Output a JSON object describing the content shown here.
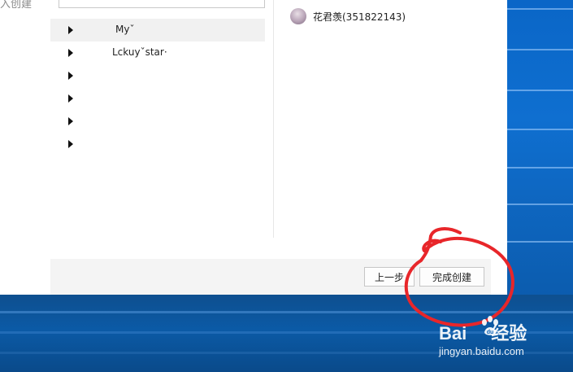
{
  "dialog": {
    "left_label": "入创建",
    "tree": [
      {
        "label": "Myˇ",
        "selected": true
      },
      {
        "label": "Lckuyˇstar·",
        "selected": false
      },
      {
        "label": "",
        "selected": false
      },
      {
        "label": "",
        "selected": false
      },
      {
        "label": "",
        "selected": false
      },
      {
        "label": "",
        "selected": false
      }
    ],
    "member": {
      "name": "花君羡(351822143)"
    },
    "footer": {
      "prev_label": "上一步",
      "finish_label": "完成创建"
    }
  },
  "annotation": {
    "color": "#e8262a"
  },
  "watermark": {
    "brand_left": "Bai",
    "brand_right": "经验",
    "url": "jingyan.baidu.com"
  },
  "colors": {
    "desktop_blue": "#0d62b5",
    "annotation_red": "#e8262a"
  }
}
